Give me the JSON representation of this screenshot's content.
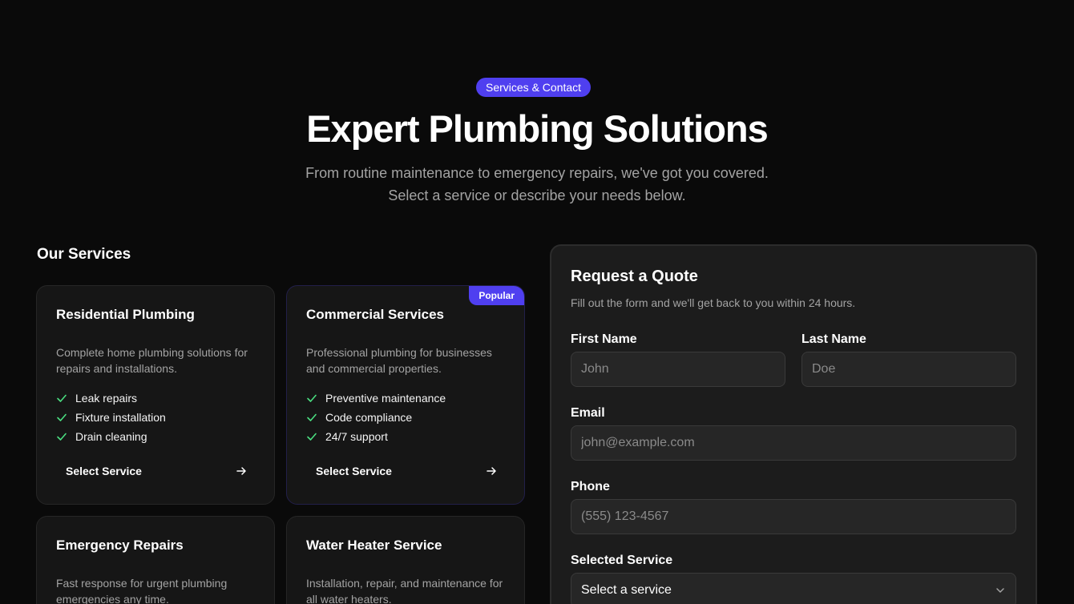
{
  "hero": {
    "badge": "Services & Contact",
    "title": "Expert Plumbing Solutions",
    "subtitle_line1": "From routine maintenance to emergency repairs, we've got you covered.",
    "subtitle_line2": "Select a service or describe your needs below."
  },
  "services": {
    "heading": "Our Services",
    "select_label": "Select Service",
    "popular_label": "Popular",
    "cards": [
      {
        "title": "Residential Plumbing",
        "desc": "Complete home plumbing solutions for repairs and installations.",
        "features": [
          "Leak repairs",
          "Fixture installation",
          "Drain cleaning"
        ]
      },
      {
        "title": "Commercial Services",
        "desc": "Professional plumbing for businesses and commercial properties.",
        "features": [
          "Preventive maintenance",
          "Code compliance",
          "24/7 support"
        ]
      },
      {
        "title": "Emergency Repairs",
        "desc": "Fast response for urgent plumbing emergencies any time."
      },
      {
        "title": "Water Heater Service",
        "desc": "Installation, repair, and maintenance for all water heaters."
      }
    ]
  },
  "quote": {
    "title": "Request a Quote",
    "subtitle": "Fill out the form and we'll get back to you within 24 hours.",
    "first_name_label": "First Name",
    "first_name_placeholder": "John",
    "last_name_label": "Last Name",
    "last_name_placeholder": "Doe",
    "email_label": "Email",
    "email_placeholder": "john@example.com",
    "phone_label": "Phone",
    "phone_placeholder": "(555) 123-4567",
    "service_label": "Selected Service",
    "service_value": "Select a service"
  },
  "colors": {
    "accent": "#4f3ff0",
    "check": "#4ade80",
    "background": "#0a0a0a"
  }
}
